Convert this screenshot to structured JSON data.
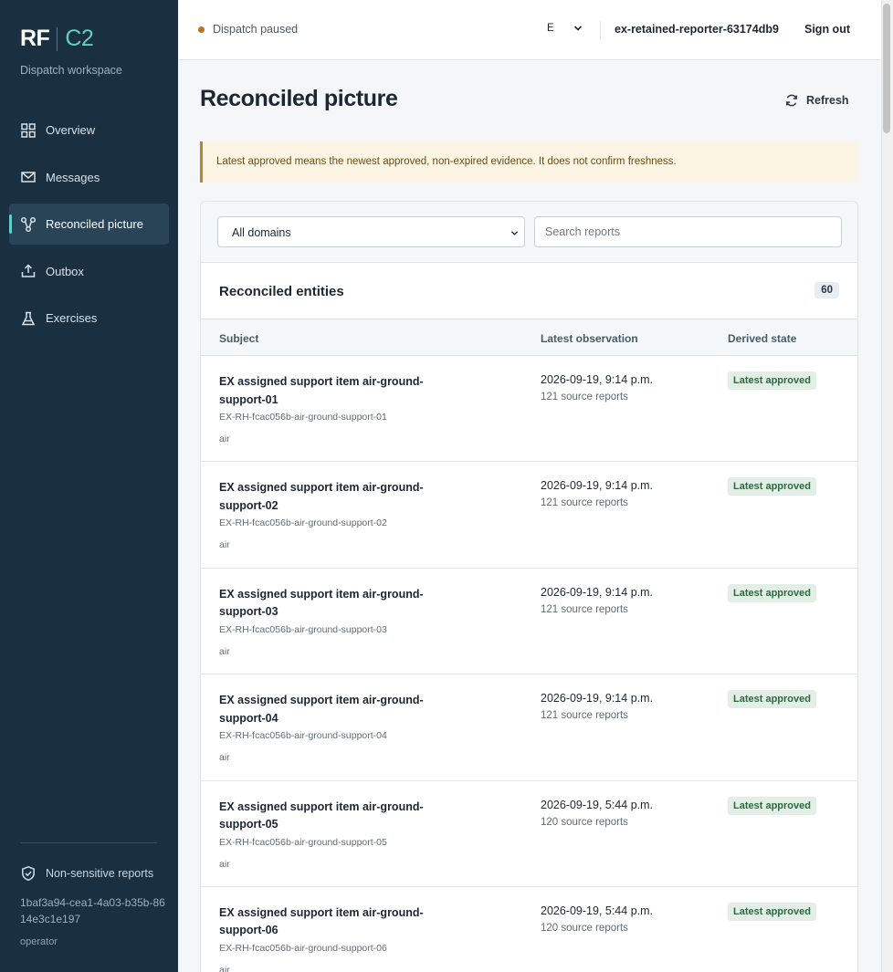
{
  "sidebar": {
    "brand_rf": "RF",
    "brand_c2": "C2",
    "subtitle": "Dispatch workspace",
    "items": [
      {
        "label": "Overview"
      },
      {
        "label": "Messages"
      },
      {
        "label": "Reconciled picture"
      },
      {
        "label": "Outbox"
      },
      {
        "label": "Exercises"
      }
    ],
    "footer_label": "Non-sensitive reports",
    "user_id": "1baf3a94-cea1-4a03-b35b-8614e3c1e197",
    "role": "operator"
  },
  "topbar": {
    "status": "Dispatch paused",
    "language": "E ",
    "user": "ex-retained-reporter-63174db9",
    "sign_out": "Sign out"
  },
  "page": {
    "title": "Reconciled picture",
    "refresh": "Refresh",
    "notice": "Latest approved means the newest approved, non-expired evidence. It does not confirm freshness."
  },
  "filters": {
    "domain_selected": "All domains",
    "search_placeholder": "Search reports"
  },
  "entities": {
    "title": "Reconciled entities",
    "count": "60",
    "columns": {
      "subject": "Subject",
      "observation": "Latest observation",
      "state": "Derived state"
    },
    "rows": [
      {
        "subject": "EX assigned support item air-ground-support-01",
        "id": "EX-RH-fcac056b-air-ground-support-01",
        "domain": "air",
        "observed": "2026-09-19, 9:14 p.m.",
        "sources": "121 source reports",
        "state": "Latest approved"
      },
      {
        "subject": "EX assigned support item air-ground-support-02",
        "id": "EX-RH-fcac056b-air-ground-support-02",
        "domain": "air",
        "observed": "2026-09-19, 9:14 p.m.",
        "sources": "121 source reports",
        "state": "Latest approved"
      },
      {
        "subject": "EX assigned support item air-ground-support-03",
        "id": "EX-RH-fcac056b-air-ground-support-03",
        "domain": "air",
        "observed": "2026-09-19, 9:14 p.m.",
        "sources": "121 source reports",
        "state": "Latest approved"
      },
      {
        "subject": "EX assigned support item air-ground-support-04",
        "id": "EX-RH-fcac056b-air-ground-support-04",
        "domain": "air",
        "observed": "2026-09-19, 9:14 p.m.",
        "sources": "121 source reports",
        "state": "Latest approved"
      },
      {
        "subject": "EX assigned support item air-ground-support-05",
        "id": "EX-RH-fcac056b-air-ground-support-05",
        "domain": "air",
        "observed": "2026-09-19, 5:44 p.m.",
        "sources": "120 source reports",
        "state": "Latest approved"
      },
      {
        "subject": "EX assigned support item air-ground-support-06",
        "id": "EX-RH-fcac056b-air-ground-support-06",
        "domain": "air",
        "observed": "2026-09-19, 5:44 p.m.",
        "sources": "120 source reports",
        "state": "Latest approved"
      }
    ]
  }
}
